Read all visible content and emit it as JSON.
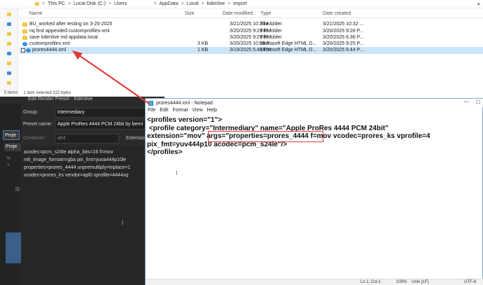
{
  "explorer": {
    "breadcrumb": [
      "This PC",
      "Local Disk (C:)",
      "Users",
      "AppData",
      "Local",
      "kdenlive",
      "export"
    ],
    "breadcrumb_sep": ">",
    "scroll_up": "▲",
    "columns": {
      "name": "Name",
      "size": "Size",
      "modified": "Date modified",
      "type": "Type",
      "created": "Date created"
    },
    "files": [
      {
        "name": "BU_worked after testing on 3-20-2025",
        "size": "",
        "modified": "3/21/2025 10:33 A...",
        "type": "File folder",
        "created": "3/21/2025 10:32 ...",
        "kind": "folder",
        "selected": false
      },
      {
        "name": "nq first appended customprofiles-xml",
        "size": "",
        "modified": "3/20/2025 9:29 PM",
        "type": "File folder",
        "created": "3/20/2025 9:28 P...",
        "kind": "folder",
        "selected": false
      },
      {
        "name": "save kdenlive md appdata local",
        "size": "",
        "modified": "3/20/2025 9:29 PM",
        "type": "File folder",
        "created": "3/20/2025 6:36 P...",
        "kind": "folder",
        "selected": false
      },
      {
        "name": "customprofiles.xml",
        "size": "3 KB",
        "modified": "3/20/2025 10:09 P...",
        "type": "Microsoft Edge HTML D...",
        "created": "3/20/2025 9:25 P...",
        "kind": "xml",
        "selected": false
      },
      {
        "name": "prores4444.xml",
        "size": "1 KB",
        "modified": "3/19/2025 5:40 PM",
        "type": "Microsoft Edge HTML D...",
        "created": "3/20/2025 6:44 P...",
        "kind": "xml",
        "selected": true
      }
    ],
    "status": {
      "items": "5 items",
      "selected": "1 item selected  222 bytes"
    }
  },
  "kdenlive": {
    "title": "Edit Render Preset - Kdenlive",
    "group_label": "Group:",
    "group_value": "Intermediary",
    "preset_label": "Preset name:",
    "preset_value": "Apple ProRes 4444 PCM 24bit by berni",
    "container_label": "Container:",
    "container_value": "a64",
    "extension_label": "Extensio",
    "tab_project1": "Proje",
    "tab_project2": "Proje",
    "small_control": "≒ ⌄",
    "args": "acodec=pcm_s24le alpha_bits=16 f=mov\nmlt_image_format=rgba pix_fmt=yuva444p10le\nproperties=prores_4444 unpremultiply=inplace=1\nvcodec=prores_ks vendor=apl0 vprofile=4444xq",
    "cursor": "I"
  },
  "notepad": {
    "title": "prores4444.xml - Notepad",
    "minimize": "—",
    "maximize": "☐",
    "menu": [
      "File",
      "Edit",
      "Format",
      "View",
      "Help"
    ],
    "content": "<profiles version=\"1\">\n <profile category=\"Intermediary\" name=\"Apple ProRes 4444 PCM 24bit\"\nextension=\"mov\" args=\"properties=prores_4444 f=mov vcodec=prores_ks vprofile=4\npix_fmt=yuv444p10 acodec=pcm_s24le\"/>\n</profiles>",
    "text_cursor": "I",
    "status": {
      "position": "Ln 1, Col 1",
      "zoom": "100%",
      "line_endings": "Unix (LF)",
      "encoding": "UTF-8"
    }
  },
  "colors": {
    "accent": "#3a8fd8",
    "highlight": "#d93b3b",
    "selected_row": "#cce4f7",
    "dark_bg": "#2b2b2b"
  },
  "icons": [
    "folder-icon",
    "xml-file-icon",
    "notepad-icon",
    "checkbox-icon",
    "scroll-up-icon"
  ]
}
